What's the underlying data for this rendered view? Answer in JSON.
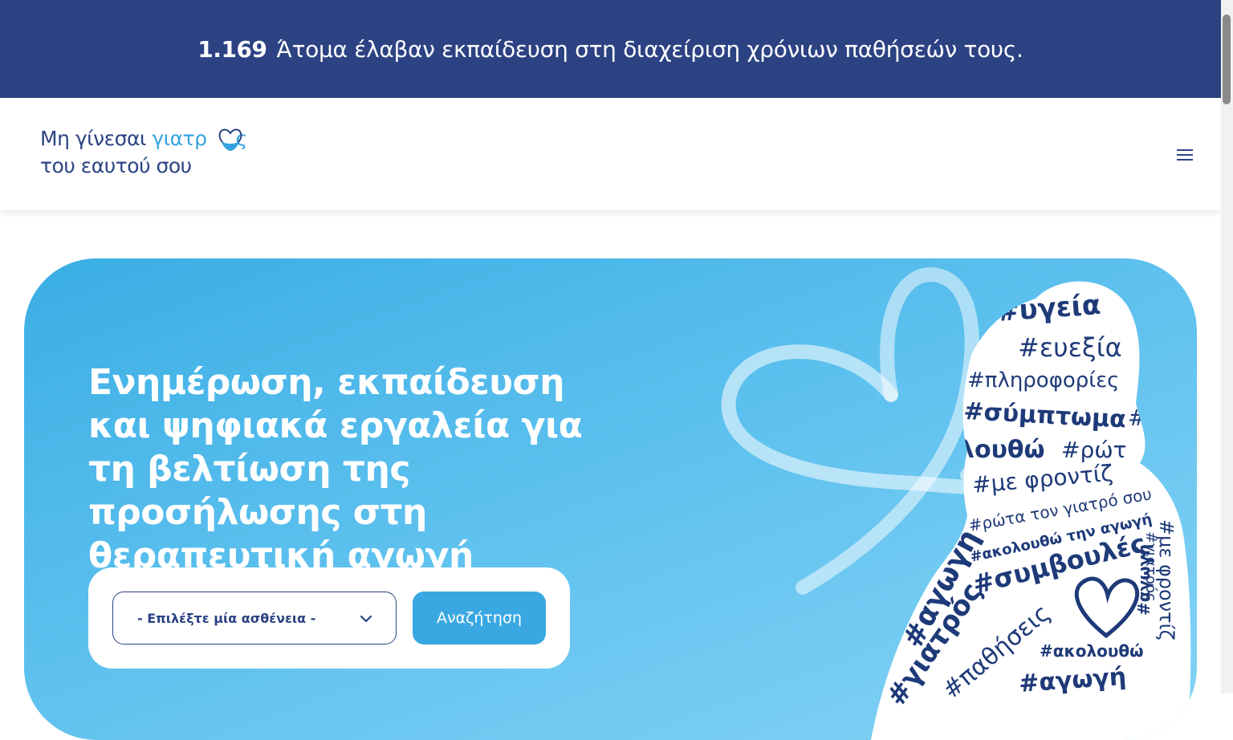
{
  "banner": {
    "count": "1.169",
    "text": "Άτομα έλαβαν εκπαίδευση στη διαχείριση χρόνιων παθήσεών τους."
  },
  "logo": {
    "line1_prefix": "Μη γίνεσαι ",
    "line1_accent": "γιατρ",
    "line1_suffix": "ς",
    "line2": "του εαυτού σου"
  },
  "header": {
    "menu_icon": "hamburger-menu-icon"
  },
  "hero": {
    "title": "Ενημέρωση, εκπαίδευση και ψηφιακά εργαλεία για τη βελτίωση της προσήλωσης στη θεραπευτική αγωγή",
    "select_placeholder": "- Επιλέξτε μία ασθένεια -",
    "search_label": "Αναζήτηση"
  },
  "hashtags": [
    "#υγεία",
    "#ευεξία",
    "#πληροφορίες",
    "#σύμπτωμα",
    "#γ",
    "λουθώ",
    "#ρώτ",
    "#με φροντίζ",
    "#ρώτα τον γιατρό σου",
    "#ακολουθώ την αγωγή",
    "#συμβουλές",
    "#αγωγή",
    "#γιατρός",
    "#παθήσεις",
    "#ακολουθώ",
    "#αγωγή",
    "#με φροντίζ",
    "#γιατρός",
    "#αγωγή"
  ],
  "colors": {
    "navy": "#2c4283",
    "brand_blue": "#35a3e0",
    "button_blue": "#39a8e2",
    "hero_start": "#3aaee4",
    "hero_end": "#86d3f5"
  }
}
